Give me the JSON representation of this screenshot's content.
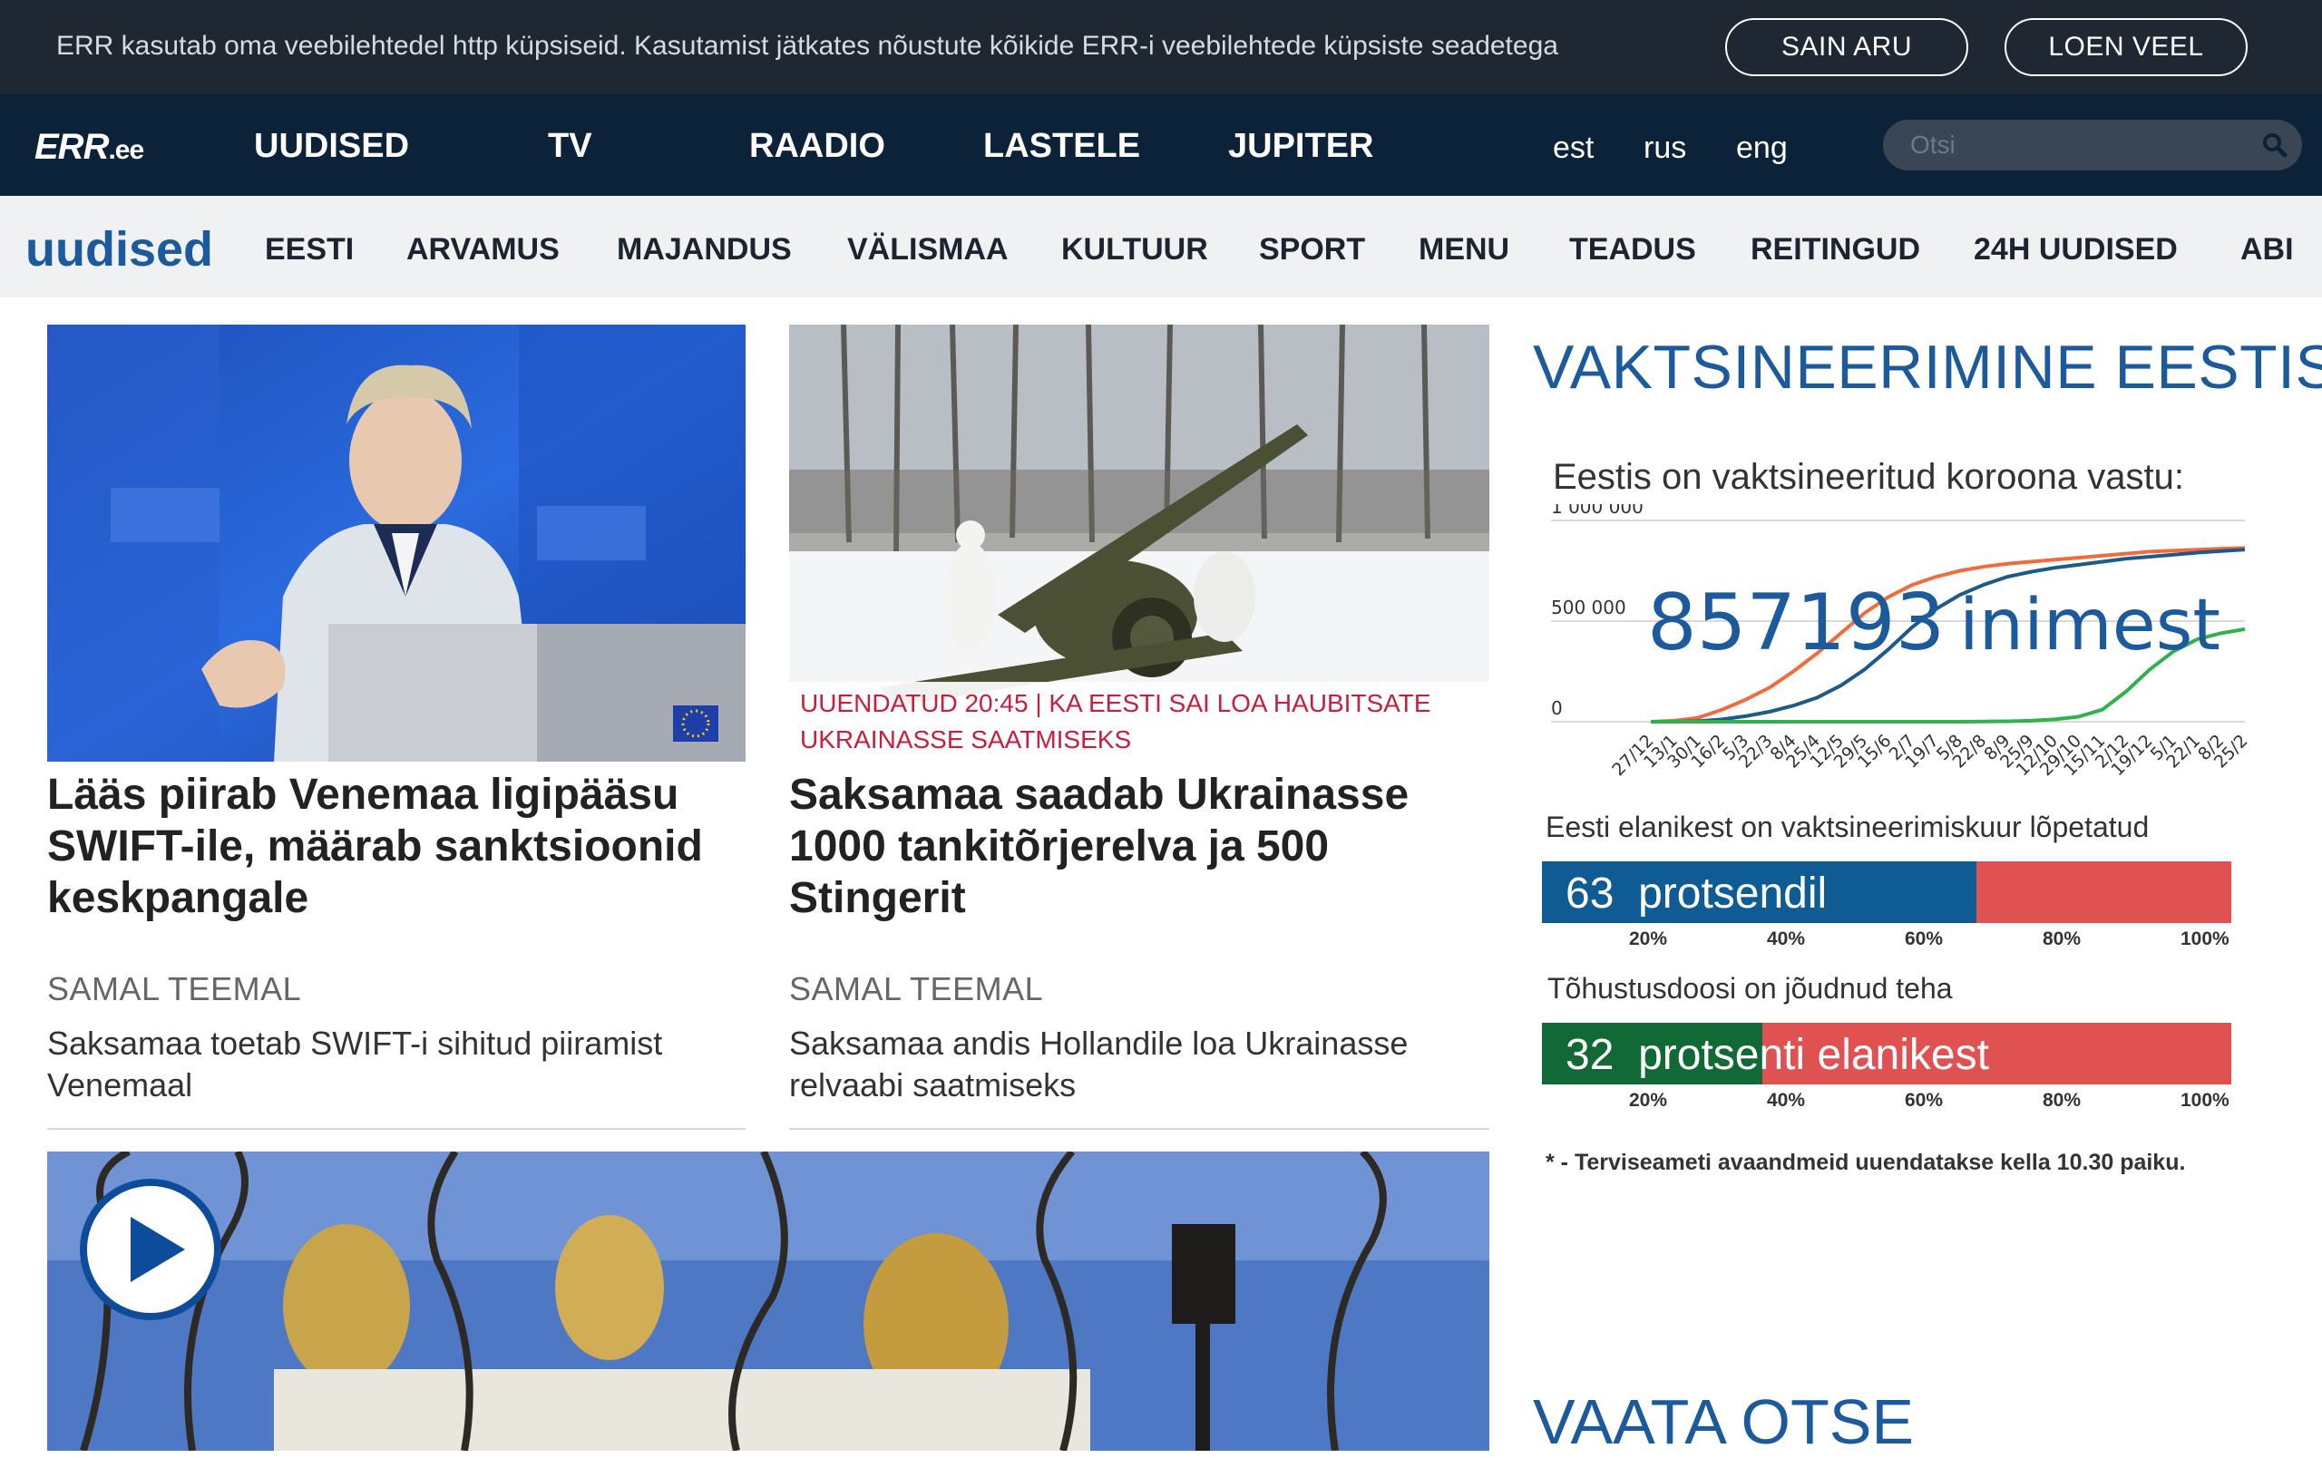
{
  "cookie": {
    "message": "ERR kasutab oma veebilehtedel http küpsiseid. Kasutamist jätkates nõustute kõikide ERR-i veebilehtede küpsiste seadetega",
    "agree_label": "SAIN ARU",
    "more_label": "LOEN VEEL"
  },
  "header": {
    "logo": "ERR",
    "logo_suffix": ".ee",
    "nav": [
      "UUDISED",
      "TV",
      "RAADIO",
      "LASTELE",
      "JUPITER"
    ],
    "languages": [
      "est",
      "rus",
      "eng"
    ],
    "search_placeholder": "Otsi",
    "search_icon": "search-icon"
  },
  "subnav": {
    "brand": "uudised",
    "items": [
      "EESTI",
      "ARVAMUS",
      "MAJANDUS",
      "VÄLISMAA",
      "KULTUUR",
      "SPORT",
      "MENU",
      "TEADUS",
      "REITINGUD",
      "24H UUDISED",
      "ABI"
    ]
  },
  "articles": [
    {
      "headline": "Lääs piirab Venemaa ligipääsu SWIFT-ile, määrab sanktsioonid keskpangale",
      "section": "SAMAL TEEMAL",
      "related": "Saksamaa toetab SWIFT-i sihitud piiramist Venemaal"
    },
    {
      "updated": "UUENDATUD 20:45 | KA EESTI SAI LOA HAUBITSATE UKRAINASSE SAATMISEKS",
      "headline": "Saksamaa saadab Ukrainasse 1000 tankitõrjerelva ja 500 Stingerit",
      "section": "SAMAL TEEMAL",
      "related": "Saksamaa andis Hollandile loa Ukrainasse relvaabi saatmiseks"
    }
  ],
  "vaccination": {
    "title": "VAKTSINEERIMINE EESTIS",
    "subtitle": "Eestis on vaktsineeritud koroona vastu:",
    "big_number": "857193",
    "big_unit": "inimest",
    "course_label": "Eesti elanikest on vaktsineerimiskuur lõpetatud",
    "course_value": "63",
    "course_unit": "protsendil",
    "booster_label": "Tõhustusdoosi on jõudnud teha",
    "booster_value": "32",
    "booster_unit": "protsenti elanikest",
    "footnote": "* - Terviseameti avaandmeid uuendatakse kella 10.30 paiku.",
    "colors": {
      "first_dose": "#f26b3a",
      "completed": "#1b5a8a",
      "booster": "#2fb24c",
      "bar_fill": "#0f5c94",
      "bar_booster": "#116a35",
      "bar_rest": "#e05252"
    }
  },
  "chart_data": [
    {
      "type": "line",
      "ylim": [
        0,
        1000000
      ],
      "yticks": [
        "0",
        "500 000",
        "1 000 000"
      ],
      "x": [
        "27/12",
        "13/1",
        "30/1",
        "16/2",
        "5/3",
        "22/3",
        "8/4",
        "25/4",
        "12/5",
        "29/5",
        "15/6",
        "2/7",
        "19/7",
        "5/8",
        "22/8",
        "8/9",
        "25/9",
        "12/10",
        "29/10",
        "15/11",
        "2/12",
        "19/12",
        "5/1",
        "22/1",
        "8/2",
        "25/2"
      ],
      "series": [
        {
          "values": [
            0,
            5000,
            20000,
            60000,
            110000,
            170000,
            250000,
            340000,
            440000,
            540000,
            620000,
            680000,
            720000,
            750000,
            770000,
            785000,
            795000,
            805000,
            815000,
            825000,
            835000,
            845000,
            850000,
            855000,
            860000,
            863000
          ]
        },
        {
          "values": [
            0,
            0,
            3000,
            12000,
            28000,
            50000,
            80000,
            120000,
            180000,
            260000,
            360000,
            470000,
            560000,
            630000,
            680000,
            720000,
            745000,
            765000,
            780000,
            795000,
            810000,
            820000,
            830000,
            840000,
            848000,
            855000
          ]
        },
        {
          "values": [
            0,
            0,
            0,
            0,
            0,
            0,
            0,
            0,
            0,
            0,
            0,
            0,
            0,
            0,
            1000,
            2000,
            5000,
            12000,
            25000,
            60000,
            150000,
            260000,
            350000,
            410000,
            440000,
            460000
          ]
        }
      ]
    },
    {
      "type": "bar",
      "categories": [
        "vaktsineerimiskuur lõpetatud"
      ],
      "values": [
        63
      ],
      "ylim": [
        0,
        100
      ],
      "ticks": [
        "20%",
        "40%",
        "60%",
        "80%",
        "100%"
      ]
    },
    {
      "type": "bar",
      "categories": [
        "tõhustusdoos"
      ],
      "values": [
        32
      ],
      "ylim": [
        0,
        100
      ],
      "ticks": [
        "20%",
        "40%",
        "60%",
        "80%",
        "100%"
      ]
    }
  ],
  "live": {
    "title": "VAATA OTSE"
  }
}
